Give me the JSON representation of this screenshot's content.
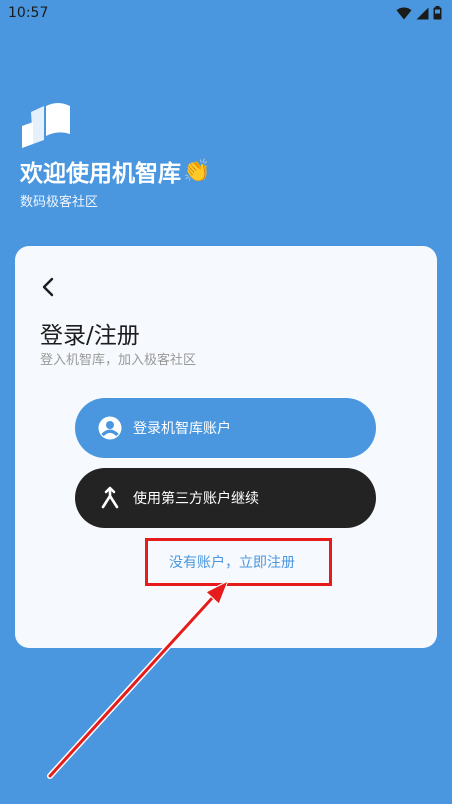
{
  "status_bar": {
    "time": "10:57",
    "icons": [
      "wifi-icon",
      "signal-icon",
      "battery-icon"
    ]
  },
  "header": {
    "title": "欢迎使用机智库",
    "title_emoji": "👏",
    "subtitle": "数码极客社区"
  },
  "card": {
    "title": "登录/注册",
    "subtitle": "登入机智库，加入极客社区",
    "login_button_label": "登录机智库账户",
    "third_party_button_label": "使用第三方账户继续",
    "register_link": "没有账户，立即注册"
  },
  "colors": {
    "background": "#4a97e0",
    "card": "#f6f9fd",
    "primary": "#4a97e0",
    "dark_button": "#232323",
    "annotation": "#e61c1c"
  }
}
